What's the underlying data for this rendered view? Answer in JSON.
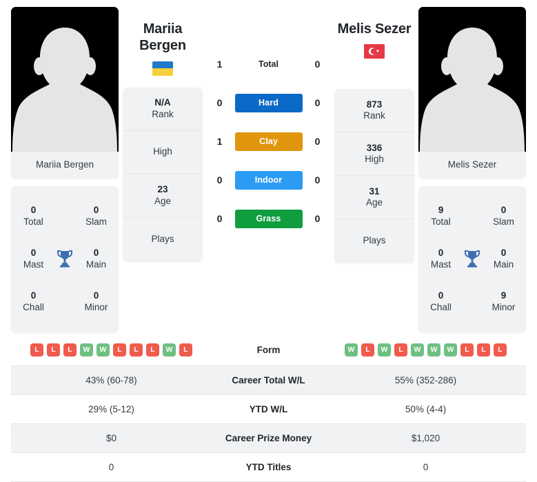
{
  "players": {
    "left": {
      "name_line1": "Mariia",
      "name_line2": "Bergen",
      "photo_caption": "Mariia Bergen",
      "flag": "ukraine-flag-icon",
      "rank_value": "N/A",
      "rank_label": "Rank",
      "high_value": "",
      "high_label": "High",
      "age_value": "23",
      "age_label": "Age",
      "plays_value": "",
      "plays_label": "Plays",
      "titles": {
        "total_value": "0",
        "total_label": "Total",
        "slam_value": "0",
        "slam_label": "Slam",
        "mast_value": "0",
        "mast_label": "Mast",
        "main_value": "0",
        "main_label": "Main",
        "chall_value": "0",
        "chall_label": "Chall",
        "minor_value": "0",
        "minor_label": "Minor"
      },
      "form": [
        "L",
        "L",
        "L",
        "W",
        "W",
        "L",
        "L",
        "L",
        "W",
        "L"
      ],
      "career_total_wl": "43% (60-78)",
      "ytd_wl": "29% (5-12)",
      "career_prize_money": "$0",
      "ytd_titles": "0"
    },
    "right": {
      "name_line1": "Melis Sezer",
      "name_line2": "",
      "photo_caption": "Melis Sezer",
      "flag": "turkey-flag-icon",
      "rank_value": "873",
      "rank_label": "Rank",
      "high_value": "336",
      "high_label": "High",
      "age_value": "31",
      "age_label": "Age",
      "plays_value": "",
      "plays_label": "Plays",
      "titles": {
        "total_value": "9",
        "total_label": "Total",
        "slam_value": "0",
        "slam_label": "Slam",
        "mast_value": "0",
        "mast_label": "Mast",
        "main_value": "0",
        "main_label": "Main",
        "chall_value": "0",
        "chall_label": "Chall",
        "minor_value": "9",
        "minor_label": "Minor"
      },
      "form": [
        "W",
        "L",
        "W",
        "L",
        "W",
        "W",
        "W",
        "L",
        "L",
        "L"
      ],
      "career_total_wl": "55% (352-286)",
      "ytd_wl": "50% (4-4)",
      "career_prize_money": "$1,020",
      "ytd_titles": "0"
    }
  },
  "h2h": {
    "rows": [
      {
        "label": "Total",
        "left": "1",
        "right": "0",
        "type": "plain",
        "color": ""
      },
      {
        "label": "Hard",
        "left": "0",
        "right": "0",
        "type": "badge",
        "color": "#0b69c7"
      },
      {
        "label": "Clay",
        "left": "1",
        "right": "0",
        "type": "badge",
        "color": "#e0960c"
      },
      {
        "label": "Indoor",
        "left": "0",
        "right": "0",
        "type": "badge",
        "color": "#2b9bf4"
      },
      {
        "label": "Grass",
        "left": "0",
        "right": "0",
        "type": "badge",
        "color": "#0f9d40"
      }
    ]
  },
  "table": {
    "rows": [
      {
        "label": "Form",
        "key": "form",
        "kind": "form"
      },
      {
        "label": "Career Total W/L",
        "key": "career_total_wl",
        "kind": "text"
      },
      {
        "label": "YTD W/L",
        "key": "ytd_wl",
        "kind": "text"
      },
      {
        "label": "Career Prize Money",
        "key": "career_prize_money",
        "kind": "text"
      },
      {
        "label": "YTD Titles",
        "key": "ytd_titles",
        "kind": "text"
      }
    ]
  },
  "colors": {
    "win_badge": "#6ec082",
    "loss_badge": "#ef5b4c",
    "trophy": "#3f6eb0",
    "card_bg": "#f1f2f3"
  }
}
